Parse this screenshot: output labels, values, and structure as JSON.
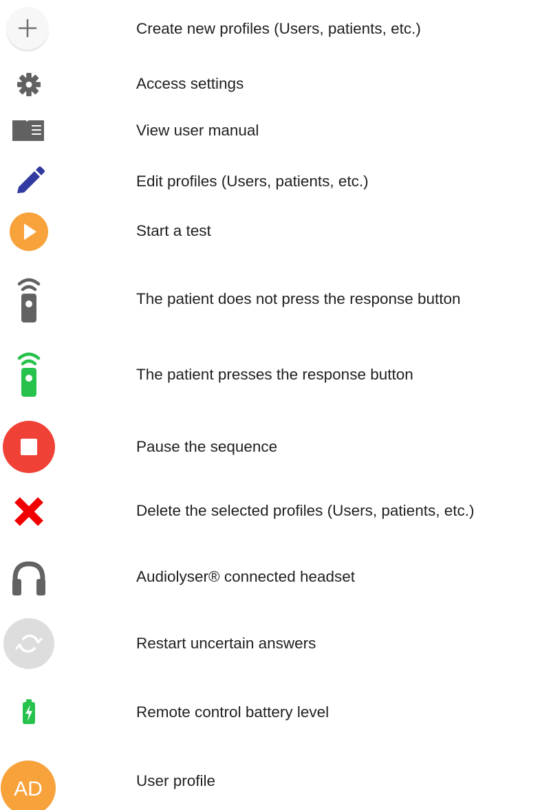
{
  "colors": {
    "orange": "#f7a23b",
    "red": "#ef4136",
    "green": "#27c24c",
    "navy": "#303aa0",
    "gray": "#626262",
    "light_gray": "#dddddd"
  },
  "legend": {
    "items": [
      {
        "icon": "add-icon",
        "label": "Create new profiles (Users, patients, etc.)"
      },
      {
        "icon": "gear-icon",
        "label": "Access settings"
      },
      {
        "icon": "book-icon",
        "label": "View user manual"
      },
      {
        "icon": "pencil-icon",
        "label": "Edit profiles (Users, patients, etc.)"
      },
      {
        "icon": "play-icon",
        "label": "Start a test"
      },
      {
        "icon": "remote-idle-icon",
        "label": "The patient does not press the response button"
      },
      {
        "icon": "remote-pressed-icon",
        "label": "The patient presses the response button"
      },
      {
        "icon": "stop-icon",
        "label": "Pause the sequence"
      },
      {
        "icon": "delete-icon",
        "label": "Delete the selected profiles (Users, patients, etc.)"
      },
      {
        "icon": "headset-icon",
        "label": "Audiolyser® connected headset"
      },
      {
        "icon": "refresh-icon",
        "label": "Restart uncertain answers"
      },
      {
        "icon": "battery-icon",
        "label": "Remote control battery level"
      },
      {
        "icon": "avatar-icon",
        "label": "User profile",
        "avatar_text": "AD"
      }
    ]
  }
}
